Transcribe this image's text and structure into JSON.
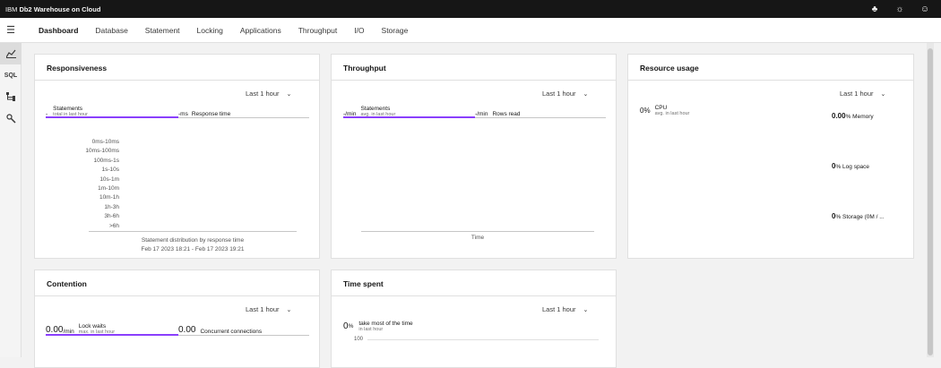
{
  "app": {
    "brand_prefix": "IBM",
    "brand_name": "Db2 Warehouse on Cloud"
  },
  "topbar_icons": [
    "notification-icon",
    "theme-icon",
    "user-icon"
  ],
  "tabs": [
    "Dashboard",
    "Database",
    "Statement",
    "Locking",
    "Applications",
    "Throughput",
    "I/O",
    "Storage"
  ],
  "active_tab": "Dashboard",
  "sidebar": [
    {
      "name": "chart-icon",
      "glyph": "⚯"
    },
    {
      "name": "sql-icon",
      "glyph": "SQL"
    },
    {
      "name": "tree-icon",
      "glyph": "⊢"
    },
    {
      "name": "wrench-icon",
      "glyph": "✎"
    }
  ],
  "responsiveness": {
    "title": "Responsiveness",
    "range": "Last 1 hour",
    "statements_value": "-",
    "statements_label": "Statements",
    "statements_sub": "total in last hour",
    "response_value": "-ms",
    "response_label": "Response time",
    "buckets": [
      "0ms-10ms",
      "10ms-100ms",
      "100ms-1s",
      "1s-10s",
      "10s-1m",
      "1m-10m",
      "10m-1h",
      "1h-3h",
      "3h-6h",
      ">6h"
    ],
    "caption": "Statement distribution by response time",
    "time_range": "Feb 17 2023 18:21 - Feb 17 2023 19:21"
  },
  "throughput": {
    "title": "Throughput",
    "range": "Last 1 hour",
    "statements_value": "-/min",
    "statements_label": "Statements",
    "statements_sub": "avg. in last hour",
    "rows_value": "-/min",
    "rows_label": "Rows read",
    "x_label": "Time"
  },
  "resource": {
    "title": "Resource usage",
    "range": "Last 1 hour",
    "cpu_value": "0%",
    "cpu_label": "CPU",
    "cpu_sub": "avg. in last hour",
    "memory_value": "0.00",
    "memory_label": "% Memory",
    "log_value": "0",
    "log_label": "% Log space",
    "storage_value": "0",
    "storage_label": "% Storage (0M / ..."
  },
  "contention": {
    "title": "Contention",
    "range": "Last 1 hour",
    "lock_value": "0.00",
    "lock_unit": "/min",
    "lock_label": "Lock waits",
    "lock_sub": "max. in last hour",
    "conn_value": "0.00",
    "conn_label": "Concurrent connections"
  },
  "timespent": {
    "title": "Time spent",
    "range": "Last 1 hour",
    "value": "0",
    "unit": "%",
    "label": "take most of the time",
    "sub": "in last hour",
    "axis_top": "100"
  }
}
